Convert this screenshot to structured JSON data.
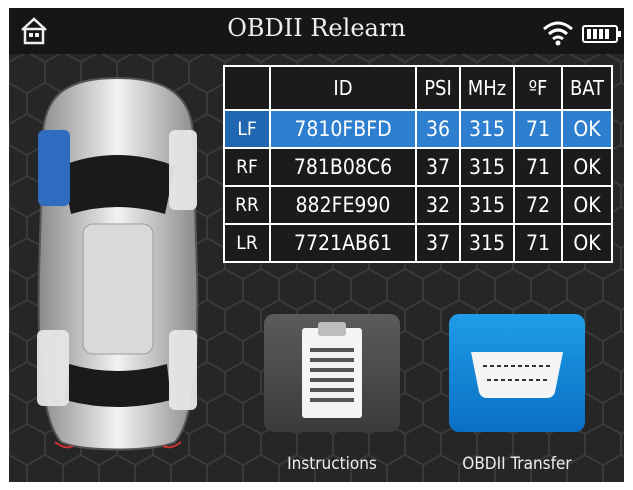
{
  "header": {
    "title": "OBDII Relearn",
    "home_icon": "home-icon",
    "wifi_icon": "wifi-icon",
    "battery_icon": "battery-icon"
  },
  "table": {
    "columns": [
      "",
      "ID",
      "PSI",
      "MHz",
      "ºF",
      "BAT"
    ],
    "rows": [
      {
        "pos": "LF",
        "id": "7810FBFD",
        "psi": "36",
        "mhz": "315",
        "temp": "71",
        "bat": "OK",
        "selected": true
      },
      {
        "pos": "RF",
        "id": "781B08C6",
        "psi": "37",
        "mhz": "315",
        "temp": "71",
        "bat": "OK"
      },
      {
        "pos": "RR",
        "id": "882FE990",
        "psi": "32",
        "mhz": "315",
        "temp": "72",
        "bat": "OK"
      },
      {
        "pos": "LR",
        "id": "7721AB61",
        "psi": "37",
        "mhz": "315",
        "temp": "71",
        "bat": "OK"
      }
    ]
  },
  "buttons": {
    "instructions": {
      "label": "Instructions",
      "icon": "clipboard-icon"
    },
    "obd_transfer": {
      "label": "OBDII Transfer",
      "icon": "obd-connector-icon"
    }
  },
  "colors": {
    "selected_row": "#2f7fd0",
    "selected_tire": "#2f6bbf",
    "obd_button": "#0a8ddb"
  }
}
